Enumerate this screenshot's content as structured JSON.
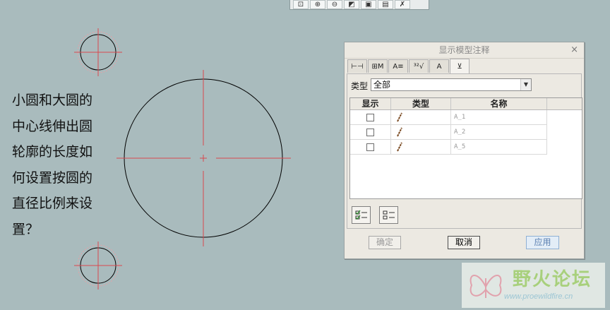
{
  "toolbar": {
    "icons": [
      "zoom-window-icon",
      "zoom-in-icon",
      "zoom-out-icon",
      "repaint-icon",
      "saved-view-icon",
      "layers-icon",
      "annotation-icon"
    ]
  },
  "question": {
    "lines": [
      "小圆和大圆的",
      "中心线伸出圆",
      "轮廓的长度如",
      "何设置按圆的",
      "直径比例来设",
      "置？"
    ]
  },
  "dialog": {
    "title": "显示模型注释",
    "close": "×",
    "tabs": [
      {
        "icon": "dimension-icon",
        "glyph": "⊢⊣"
      },
      {
        "icon": "geometric-tolerance-icon",
        "glyph": "⊞M"
      },
      {
        "icon": "note-icon",
        "glyph": "A≡"
      },
      {
        "icon": "surface-finish-icon",
        "glyph": "³²√"
      },
      {
        "icon": "datum-target-icon",
        "glyph": "A"
      },
      {
        "icon": "datum-icon",
        "glyph": "⊻"
      }
    ],
    "type_label": "类型",
    "type_value": "全部",
    "columns": [
      "显示",
      "类型",
      "名称"
    ],
    "rows": [
      {
        "name": "A_1",
        "checked": false
      },
      {
        "name": "A_2",
        "checked": false
      },
      {
        "name": "A_5",
        "checked": false
      }
    ],
    "ok_label": "确定",
    "cancel_label": "取消",
    "apply_label": "应用"
  },
  "watermark": {
    "title": "野火论坛",
    "url": "www.proewildfire.cn"
  },
  "colors": {
    "background": "#a9bbbd",
    "centerline": "#d9484f",
    "circle": "#000000"
  }
}
